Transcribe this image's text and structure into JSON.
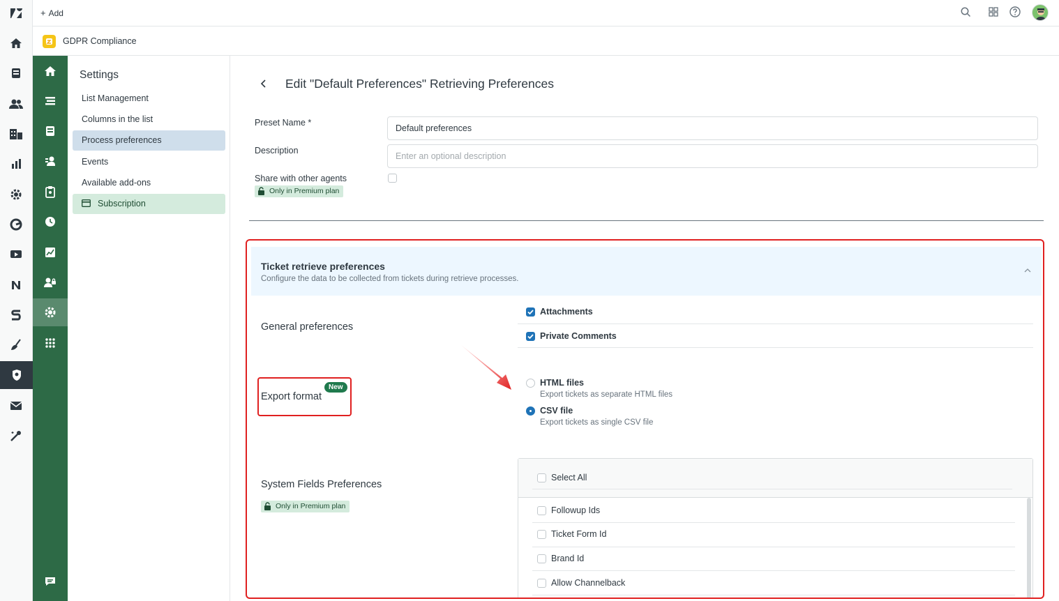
{
  "topbar": {
    "add_label": "Add"
  },
  "app": {
    "name": "GDPR Compliance"
  },
  "settings": {
    "title": "Settings",
    "items": [
      {
        "label": "List Management"
      },
      {
        "label": "Columns in the list"
      },
      {
        "label": "Process preferences"
      },
      {
        "label": "Events"
      },
      {
        "label": "Available add-ons"
      },
      {
        "label": "Subscription"
      }
    ]
  },
  "page": {
    "title": "Edit \"Default Preferences\" Retrieving Preferences",
    "preset_name_label": "Preset Name *",
    "preset_name_value": "Default preferences",
    "description_label": "Description",
    "description_placeholder": "Enter an optional description",
    "share_label": "Share with other agents",
    "premium_badge": "Only in Premium plan"
  },
  "section": {
    "title": "Ticket retrieve preferences",
    "subtitle": "Configure the data to be collected from tickets during retrieve processes.",
    "general_label": "General preferences",
    "general_options": [
      {
        "label": "Attachments",
        "checked": true
      },
      {
        "label": "Private Comments",
        "checked": true
      }
    ],
    "export_label": "Export format",
    "new_badge": "New",
    "export_options": [
      {
        "label": "HTML files",
        "desc": "Export tickets as separate HTML files",
        "selected": false
      },
      {
        "label": "CSV file",
        "desc": "Export tickets as single CSV file",
        "selected": true
      }
    ],
    "system_label": "System Fields Preferences",
    "system_premium_badge": "Only in Premium plan",
    "select_all_label": "Select All",
    "system_fields": [
      {
        "label": "Followup Ids"
      },
      {
        "label": "Ticket Form Id"
      },
      {
        "label": "Brand Id"
      },
      {
        "label": "Allow Channelback"
      }
    ]
  },
  "colors": {
    "app_nav": "#2d6a46",
    "accent": "#1f73b7",
    "highlight": "#e02020",
    "new_badge": "#1f7a4d"
  }
}
